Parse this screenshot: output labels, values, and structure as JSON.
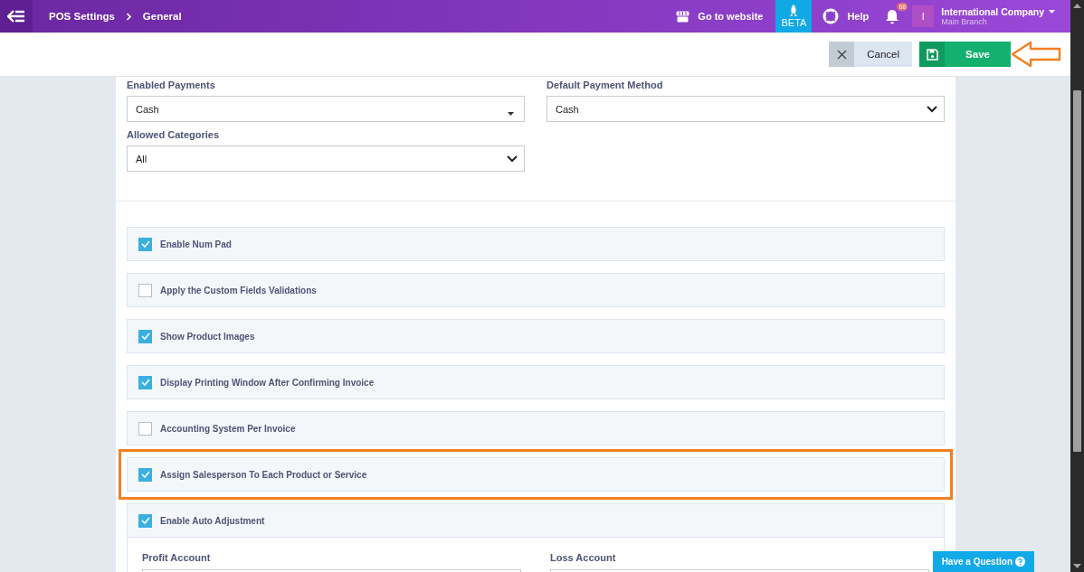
{
  "topbar": {
    "breadcrumb": [
      "POS Settings",
      "General"
    ],
    "website_link": "Go to website",
    "beta": "BETA",
    "help": "Help",
    "notifications": "68",
    "avatar": "I",
    "company": "International Company",
    "branch": "Main Branch"
  },
  "actions": {
    "cancel": "Cancel",
    "save": "Save",
    "save_pointed": true
  },
  "fields": [
    {
      "label": "Enabled Payments",
      "value": "Cash",
      "kind": "multi"
    },
    {
      "label": "Default Payment Method",
      "value": "Cash",
      "kind": "select"
    },
    {
      "label": "Allowed Categories",
      "value": "All",
      "kind": "select"
    }
  ],
  "options": [
    {
      "label": "Enable Num Pad",
      "checked": true,
      "highlighted": false
    },
    {
      "label": "Apply the Custom Fields Validations",
      "checked": false,
      "highlighted": false
    },
    {
      "label": "Show Product Images",
      "checked": true,
      "highlighted": false
    },
    {
      "label": "Display Printing Window After Confirming Invoice",
      "checked": true,
      "highlighted": false
    },
    {
      "label": "Accounting System Per Invoice",
      "checked": false,
      "highlighted": false
    },
    {
      "label": "Assign Salesperson To Each Product or Service",
      "checked": true,
      "highlighted": true
    },
    {
      "label": "Enable Auto Adjustment",
      "checked": true,
      "highlighted": false,
      "subfields": [
        "Profit Account",
        "Loss Account"
      ]
    }
  ],
  "help_button": "Have a Question"
}
